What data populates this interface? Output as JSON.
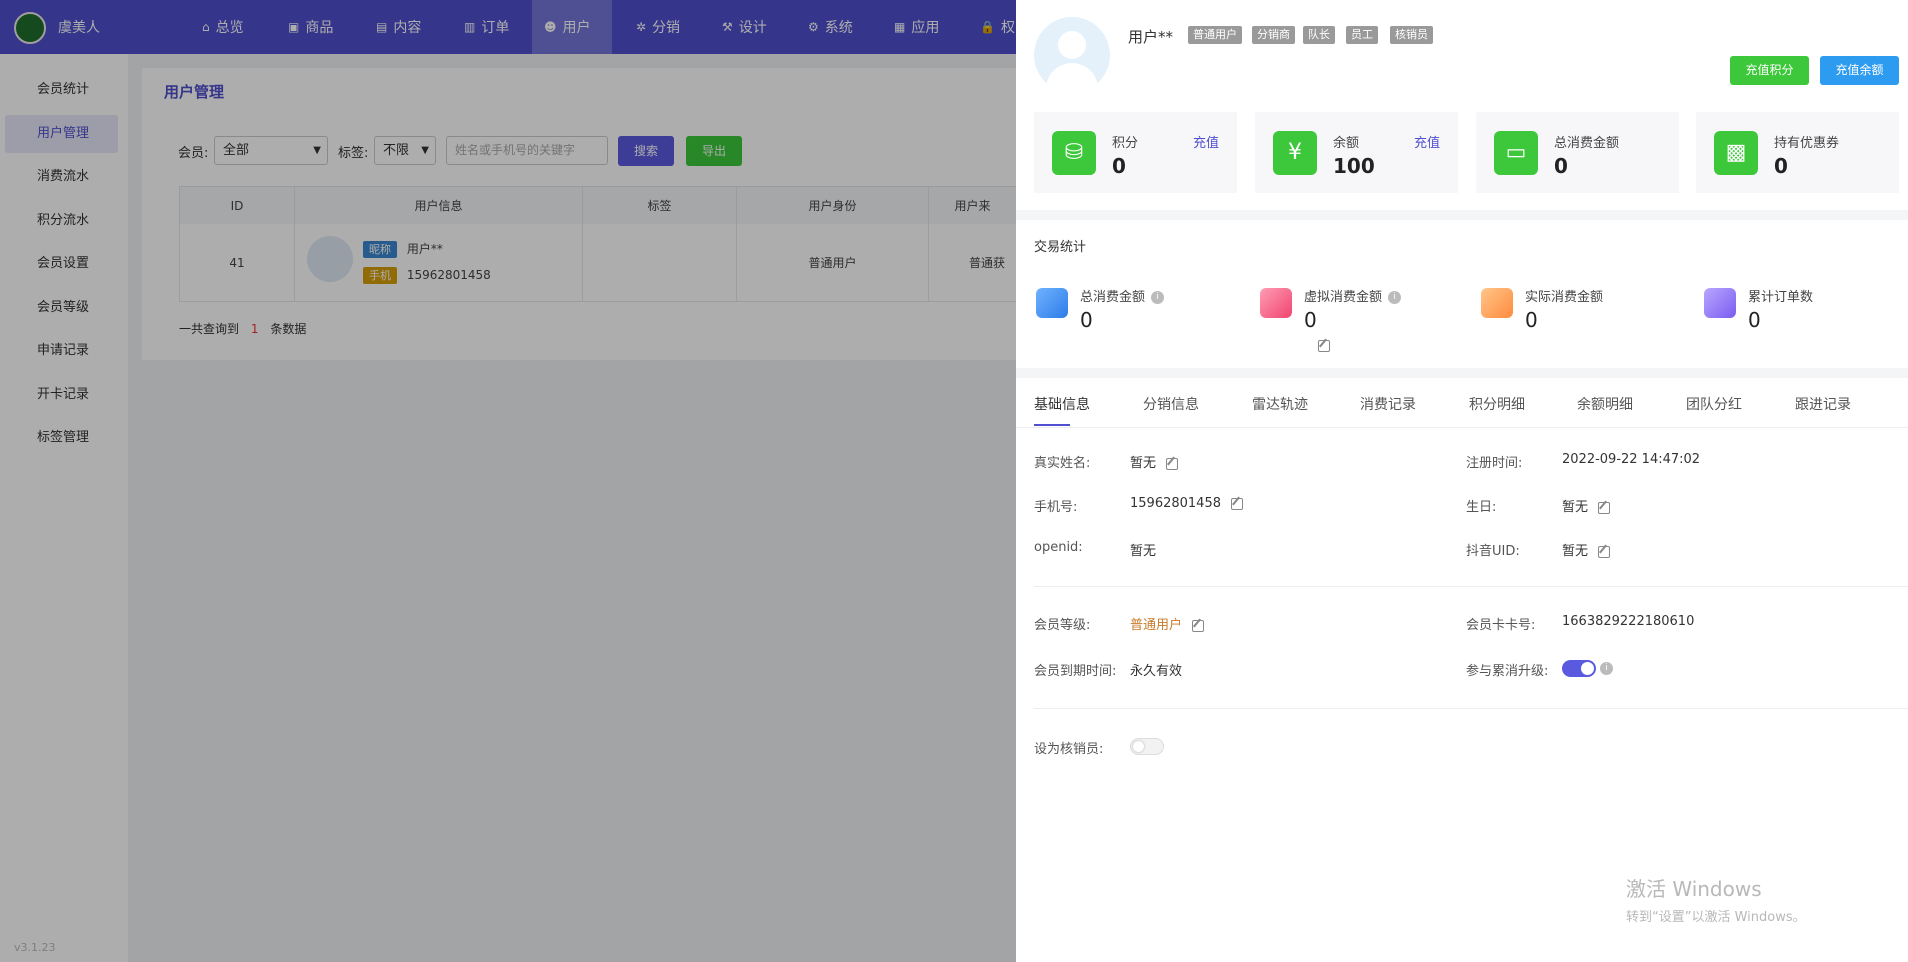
{
  "brand": "虞美人",
  "nav": [
    "总览",
    "商品",
    "内容",
    "订单",
    "用户",
    "分销",
    "设计",
    "系统",
    "应用",
    "权"
  ],
  "nav_icons": [
    "home-icon",
    "bag-icon",
    "file-icon",
    "clipboard-icon",
    "user-icon",
    "share-icon",
    "hammer-icon",
    "gear-icon",
    "grid-icon",
    "lock-icon"
  ],
  "sidebar": [
    "会员统计",
    "用户管理",
    "消费流水",
    "积分流水",
    "会员设置",
    "会员等级",
    "申请记录",
    "开卡记录",
    "标签管理"
  ],
  "version": "v3.1.23",
  "page_title": "用户管理",
  "filter": {
    "member_label": "会员:",
    "member_value": "全部",
    "tag_label": "标签:",
    "tag_value": "不限",
    "search_placeholder": "姓名或手机号的关键字",
    "search_btn": "搜索",
    "export_btn": "导出"
  },
  "table": {
    "headers": [
      "ID",
      "用户信息",
      "标签",
      "用户身份",
      "用户来"
    ],
    "row": {
      "id": "41",
      "nick_tag": "昵称",
      "nickname": "用户**",
      "phone_tag": "手机",
      "phone": "15962801458",
      "tags": "",
      "identity": "普通用户",
      "source": "普通获"
    }
  },
  "summary": {
    "prefix": "一共查询到",
    "count": "1",
    "suffix": "条数据"
  },
  "drawer": {
    "username": "用户**",
    "tags": [
      "普通用户",
      "分销商",
      "队长",
      "员工",
      "核销员"
    ],
    "recharge_points_btn": "充值积分",
    "recharge_balance_btn": "充值余额",
    "cards": [
      {
        "label": "积分",
        "value": "0",
        "link": "充值",
        "icon": "coins-icon"
      },
      {
        "label": "余额",
        "value": "100",
        "link": "充值",
        "icon": "money-bag-icon"
      },
      {
        "label": "总消费金额",
        "value": "0",
        "link": "",
        "icon": "wallet-icon"
      },
      {
        "label": "持有优惠券",
        "value": "0",
        "link": "",
        "icon": "ticket-icon"
      }
    ],
    "trade_title": "交易统计",
    "stats": [
      {
        "label": "总消费金额",
        "value": "0"
      },
      {
        "label": "虚拟消费金额",
        "value": "0"
      },
      {
        "label": "实际消费金额",
        "value": "0"
      },
      {
        "label": "累计订单数",
        "value": "0"
      }
    ],
    "tabs": [
      "基础信息",
      "分销信息",
      "雷达轨迹",
      "消费记录",
      "积分明细",
      "余额明细",
      "团队分红",
      "跟进记录"
    ],
    "fields": {
      "real_name_label": "真实姓名:",
      "real_name": "暂无",
      "register_label": "注册时间:",
      "register": "2022-09-22 14:47:02",
      "phone_label": "手机号:",
      "phone": "15962801458",
      "birthday_label": "生日:",
      "birthday": "暂无",
      "openid_label": "openid:",
      "openid": "暂无",
      "douyin_label": "抖音UID:",
      "douyin": "暂无",
      "level_label": "会员等级:",
      "level": "普通用户",
      "card_no_label": "会员卡卡号:",
      "card_no": "1663829222180610",
      "expire_label": "会员到期时间:",
      "expire": "永久有效",
      "upgrade_label": "参与累消升级:",
      "verifier_label": "设为核销员:"
    }
  },
  "watermark": {
    "line1": "激活 Windows",
    "line2": "转到“设置”以激活 Windows。"
  },
  "colors": {
    "primary": "#4f4fcf",
    "green": "#3cc83a",
    "blue": "#2d9bf0",
    "level": "#c87a2a"
  }
}
